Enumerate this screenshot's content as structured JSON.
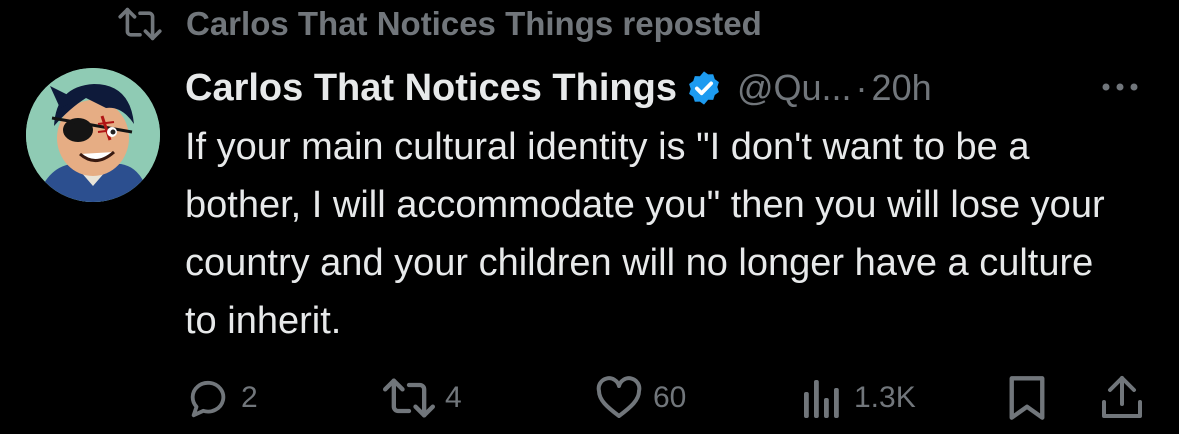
{
  "social_context": {
    "icon": "repost-icon",
    "text": "Carlos That Notices Things reposted"
  },
  "tweet": {
    "author": {
      "display_name": "Carlos That Notices Things",
      "verified": true,
      "handle": "@Qu...",
      "avatar": "cartoon-eyepatch-avatar"
    },
    "separator": "·",
    "timestamp": "20h",
    "text": "If your main cultural identity is \"I don't want to be a bother, I will accommodate you\" then you will lose your country and your children will no longer have a culture to inherit.",
    "actions": {
      "replies": "2",
      "reposts": "4",
      "likes": "60",
      "views": "1.3K"
    }
  },
  "colors": {
    "background": "#000000",
    "primary_text": "#e7e9ea",
    "secondary_text": "#71767b",
    "verified_badge": "#1d9bf0"
  }
}
